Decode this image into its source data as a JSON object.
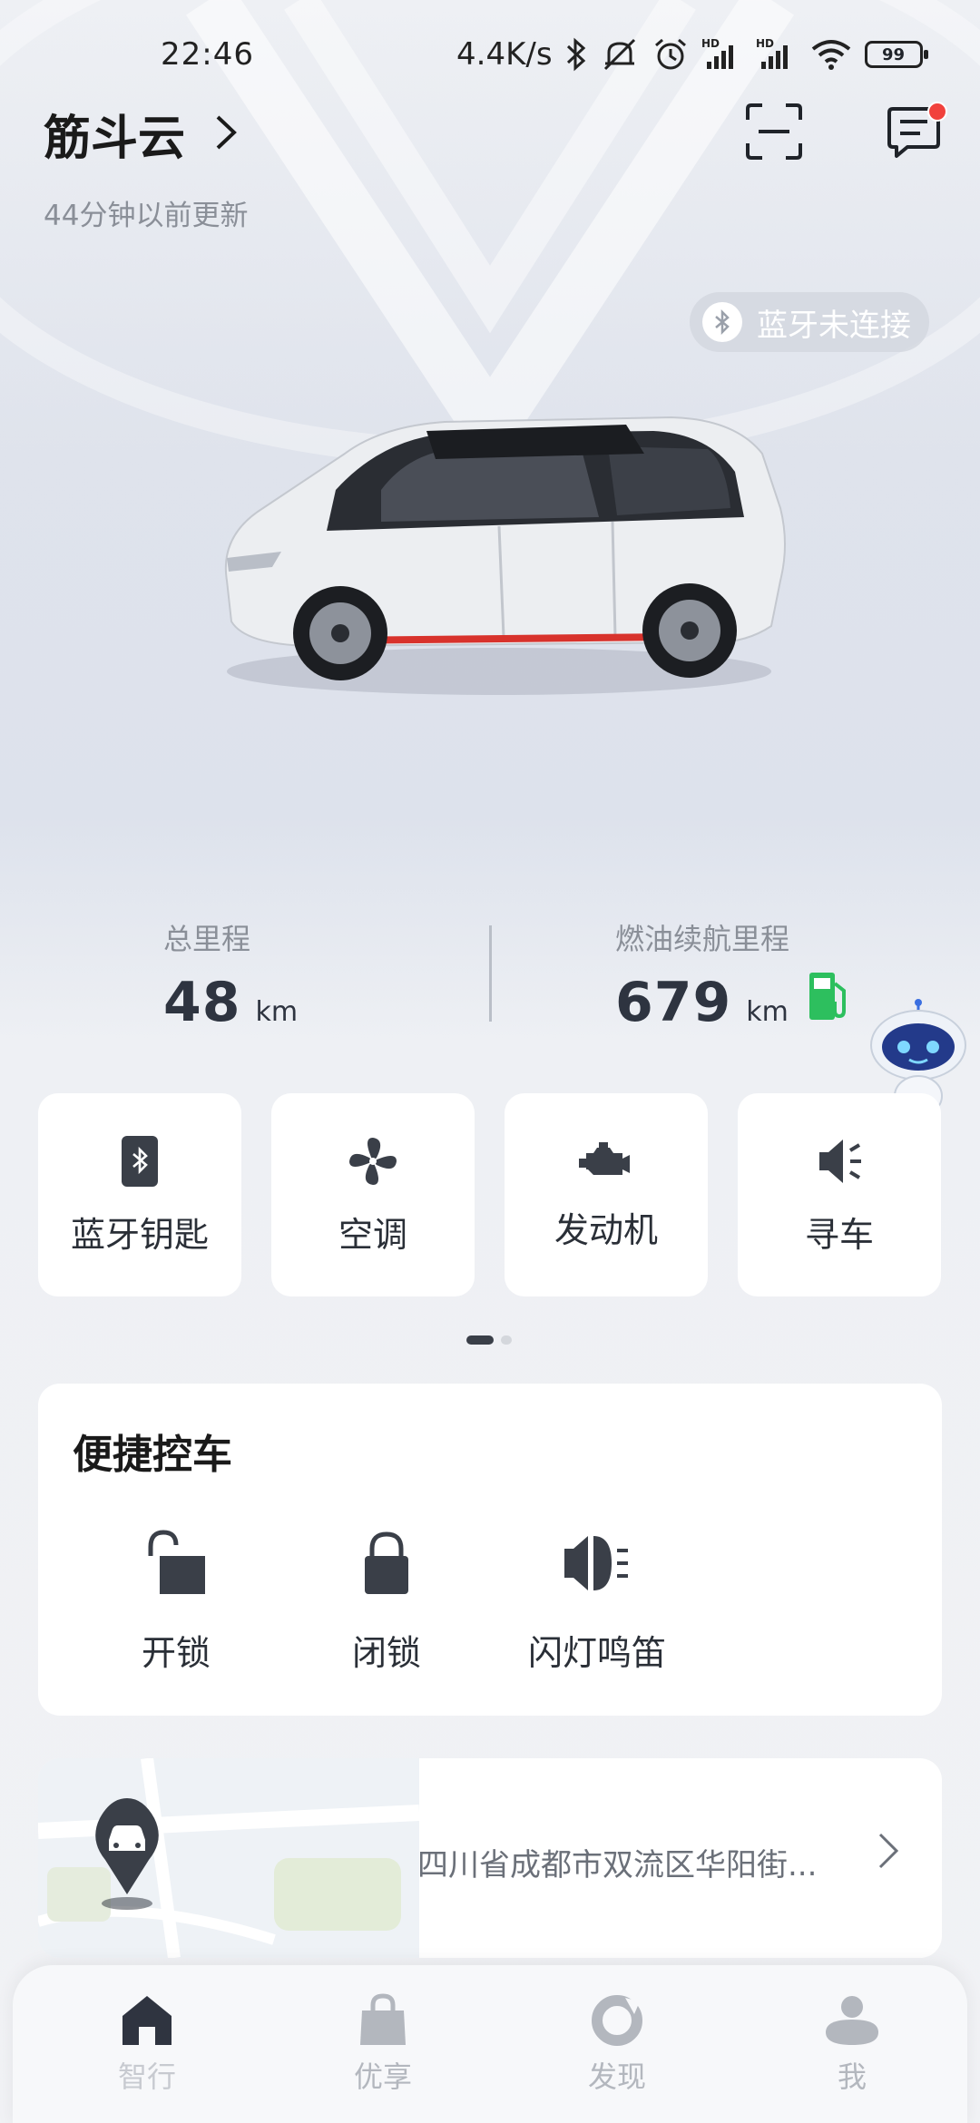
{
  "status_bar": {
    "time": "22:46",
    "speed": "4.4K/s",
    "battery": "99"
  },
  "header": {
    "title": "筋斗云",
    "updated": "44分钟以前更新"
  },
  "bluetooth_status": "蓝牙未连接",
  "stats": {
    "total": {
      "label": "总里程",
      "value": "48",
      "unit": "km"
    },
    "range": {
      "label": "燃油续航里程",
      "value": "679",
      "unit": "km"
    }
  },
  "quick_actions": [
    {
      "label": "蓝牙钥匙",
      "icon": "bluetooth-key-icon"
    },
    {
      "label": "空调",
      "icon": "fan-icon"
    },
    {
      "label": "发动机",
      "icon": "engine-icon"
    },
    {
      "label": "寻车",
      "icon": "horn-icon"
    }
  ],
  "control": {
    "title": "便捷控车",
    "unlock": "开锁",
    "lock": "闭锁",
    "flash_honk": "闪灯鸣笛"
  },
  "location": {
    "address": "四川省成都市双流区华阳街..."
  },
  "nav": {
    "home": "智行",
    "benefits": "优享",
    "discover": "发现",
    "me": "我"
  },
  "colors": {
    "accent_red": "#f1413c",
    "fuel_green": "#2dbf5e",
    "icon_dark": "#3a3f48"
  }
}
